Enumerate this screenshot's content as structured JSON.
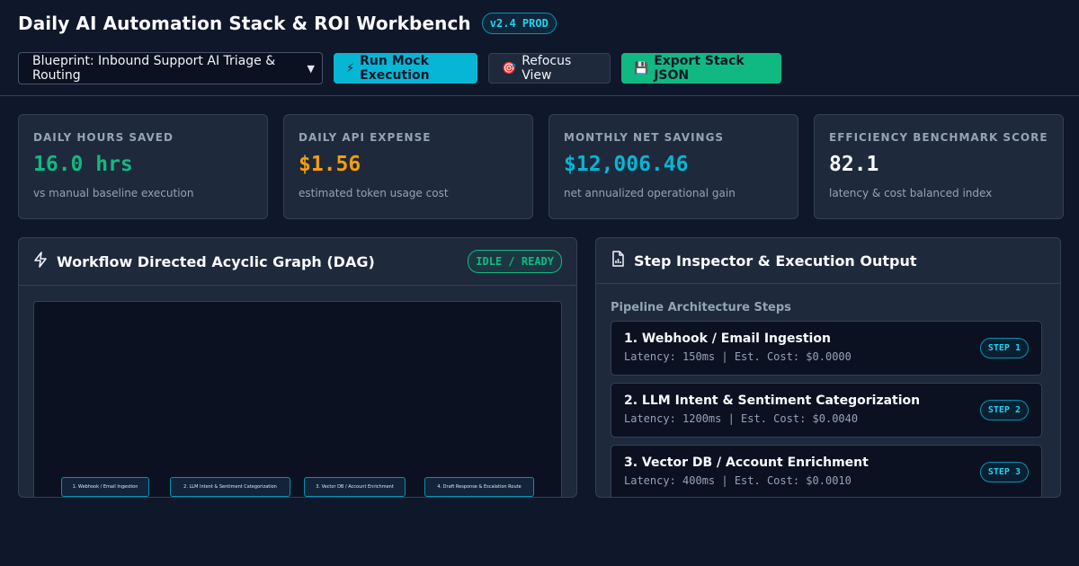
{
  "header": {
    "title": "Daily AI Automation Stack & ROI Workbench",
    "version": "v2.4 PROD"
  },
  "toolbar": {
    "blueprint_selected": "Blueprint: Inbound Support AI Triage & Routing",
    "run_label": "Run Mock Execution",
    "run_icon": "⚡",
    "refocus_label": "Refocus View",
    "refocus_icon": "🎯",
    "export_label": "Export Stack JSON",
    "export_icon": "💾"
  },
  "metrics": [
    {
      "label": "DAILY HOURS SAVED",
      "value": "16.0 hrs",
      "sub": "vs manual baseline execution",
      "color": "#10b981"
    },
    {
      "label": "DAILY API EXPENSE",
      "value": "$1.56",
      "sub": "estimated token usage cost",
      "color": "#f59e0b"
    },
    {
      "label": "MONTHLY NET SAVINGS",
      "value": "$12,006.46",
      "sub": "net annualized operational gain",
      "color": "#06b6d4"
    },
    {
      "label": "EFFICIENCY BENCHMARK SCORE",
      "value": "82.1",
      "sub": "latency & cost balanced index",
      "color": "#f8fafc"
    }
  ],
  "dag_panel": {
    "title": "Workflow Directed Acyclic Graph (DAG)",
    "status": "IDLE / READY",
    "nodes": [
      "1. Webhook / Email Ingestion",
      "2. LLM Intent & Sentiment Categorization",
      "3. Vector DB / Account Enrichment",
      "4. Draft Response & Escalation Route"
    ]
  },
  "inspector_panel": {
    "title": "Step Inspector & Execution Output",
    "steps_heading": "Pipeline Architecture Steps",
    "steps": [
      {
        "title": "1. Webhook / Email Ingestion",
        "meta": "Latency: 150ms | Est. Cost: $0.0000",
        "badge": "STEP 1"
      },
      {
        "title": "2. LLM Intent & Sentiment Categorization",
        "meta": "Latency: 1200ms | Est. Cost: $0.0040",
        "badge": "STEP 2"
      },
      {
        "title": "3. Vector DB / Account Enrichment",
        "meta": "Latency: 400ms | Est. Cost: $0.0010",
        "badge": "STEP 3"
      }
    ]
  }
}
